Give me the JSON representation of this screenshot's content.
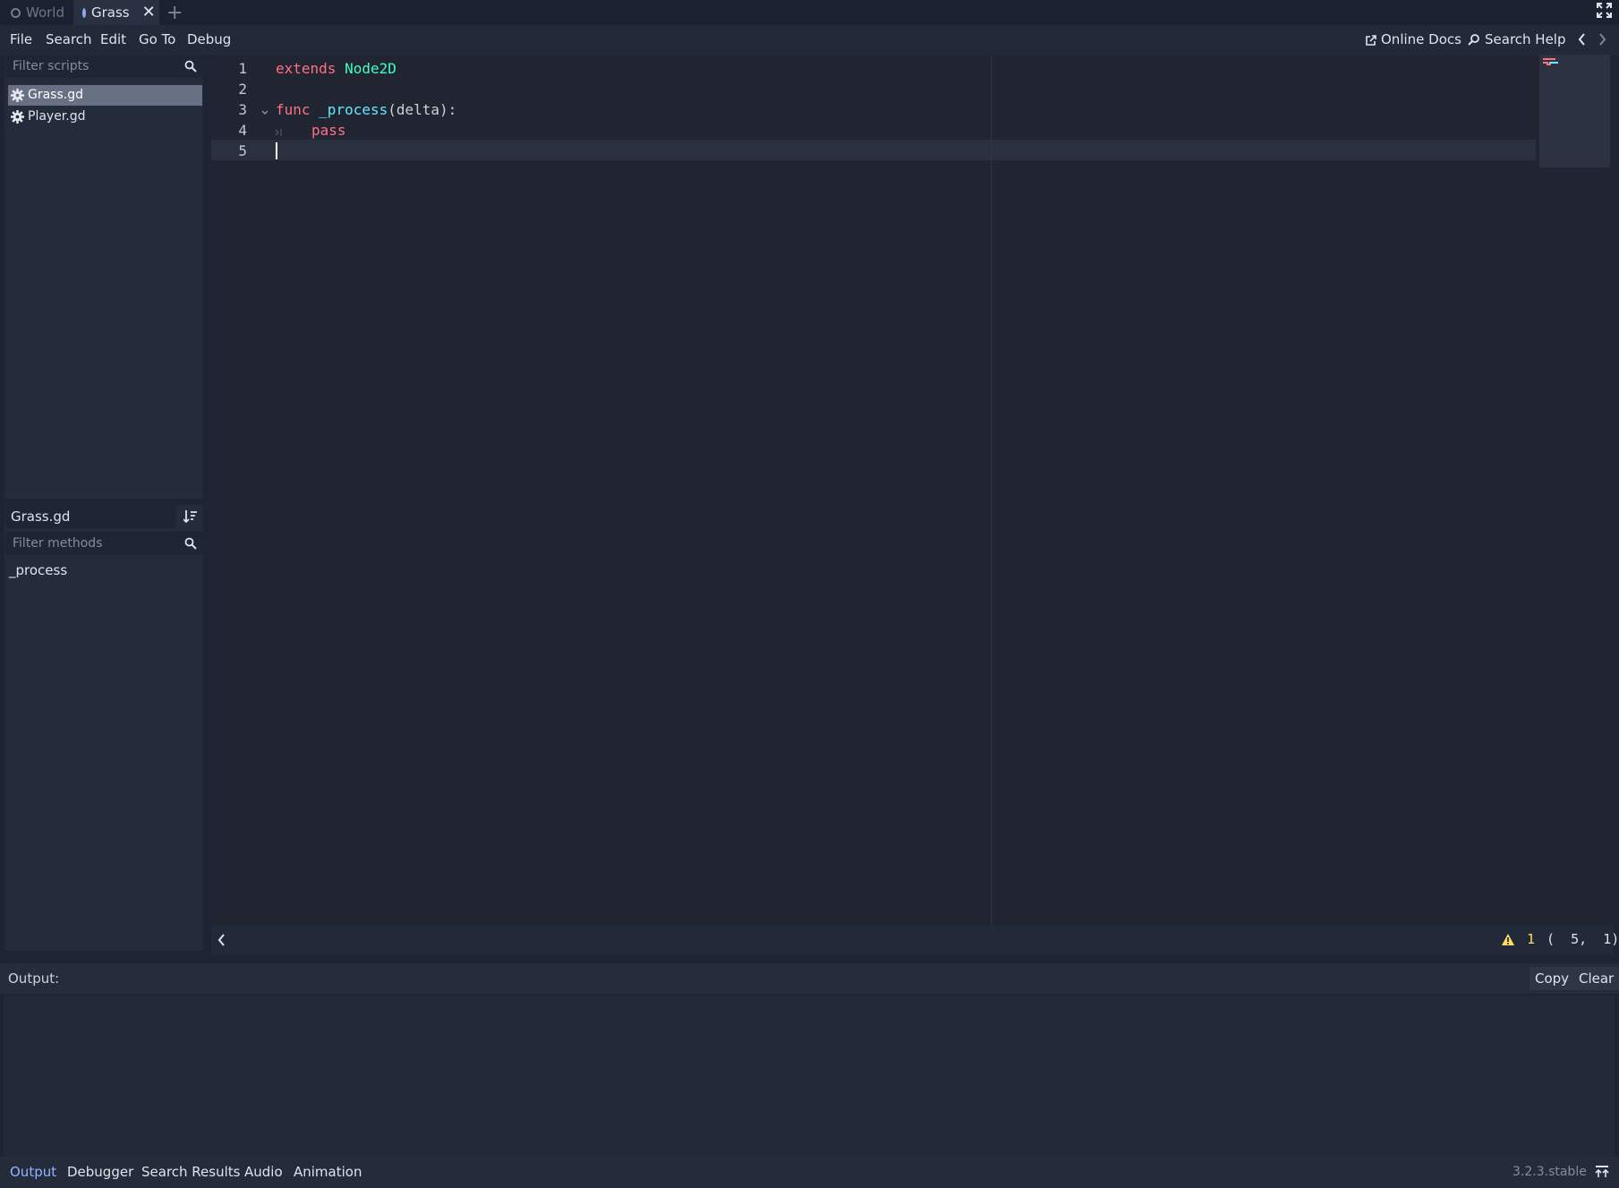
{
  "scene_tabs": {
    "world": "World",
    "grass": "Grass",
    "close_symbol": "✕",
    "add_symbol": "+"
  },
  "menu": {
    "file": "File",
    "search": "Search",
    "edit": "Edit",
    "goto": "Go To",
    "debug": "Debug",
    "online_docs": "Online Docs",
    "search_help": "Search Help"
  },
  "scripts_panel": {
    "filter_placeholder": "Filter scripts",
    "items": [
      {
        "label": "Grass.gd",
        "selected": true
      },
      {
        "label": "Player.gd",
        "selected": false
      }
    ]
  },
  "methods_panel": {
    "current_script": "Grass.gd",
    "filter_placeholder": "Filter methods",
    "items": [
      "_process"
    ]
  },
  "editor": {
    "line_numbers": [
      "1",
      "2",
      "3",
      "4",
      "5"
    ],
    "code": {
      "l1_kw": "extends",
      "l1_type": "Node2D",
      "l3_kw": "func",
      "l3_fn": "_process",
      "l3_args": "(delta):",
      "l4_kw": "pass"
    },
    "colors": {
      "keyword": "#ff7085",
      "type": "#42ffc2",
      "function": "#66e6ff"
    }
  },
  "editor_status": {
    "warning_count": "1",
    "position": "(  5,  1)"
  },
  "output": {
    "label": "Output:",
    "copy": "Copy",
    "clear": "Clear"
  },
  "bottom_tabs": {
    "output": "Output",
    "debugger": "Debugger",
    "search_results": "Search Results",
    "audio": "Audio",
    "animation": "Animation"
  },
  "version": "3.2.3.stable"
}
